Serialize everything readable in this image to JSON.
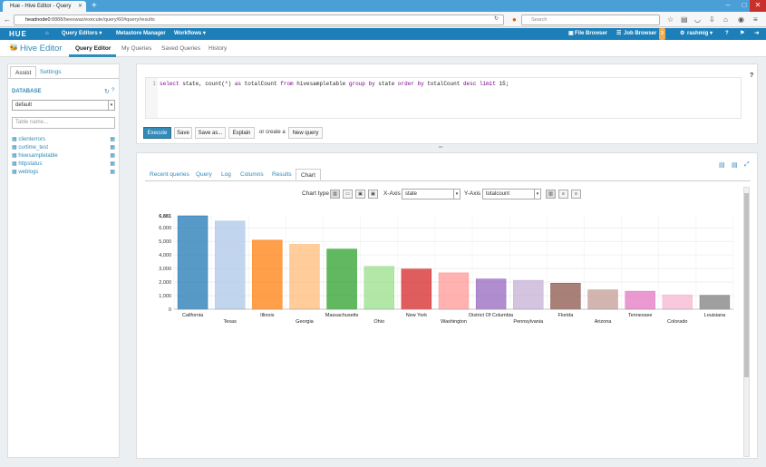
{
  "browser": {
    "tab_title": "Hue - Hive Editor - Query",
    "url_host": "headnode0",
    "url_rest": ":8888/beeswax/execute/query/60#query/results",
    "search_placeholder": "Search"
  },
  "hue_nav": {
    "logo": "HUE",
    "items": [
      "Query Editors ▾",
      "Metastore Manager",
      "Workflows ▾"
    ],
    "file_browser": "File Browser",
    "job_browser": "Job Browser",
    "job_badge": "3",
    "user": "rashmig ▾"
  },
  "subnav": {
    "title": "Hive Editor",
    "tabs": [
      "Query Editor",
      "My Queries",
      "Saved Queries",
      "History"
    ]
  },
  "assist": {
    "tabs": [
      "Assist",
      "Settings"
    ],
    "database_label": "DATABASE",
    "database_value": "default",
    "table_placeholder": "Table name...",
    "tables": [
      "clienterrors",
      "curtime_test",
      "hivesampletable",
      "httpstatus",
      "weblogs"
    ]
  },
  "editor": {
    "line_number": "1",
    "code_parts": [
      {
        "t": "select",
        "k": true
      },
      {
        "t": " state, count(*) ",
        "k": false
      },
      {
        "t": "as",
        "k": true
      },
      {
        "t": " totalCount ",
        "k": false
      },
      {
        "t": "from",
        "k": true
      },
      {
        "t": " hivesampletable ",
        "k": false
      },
      {
        "t": "group by",
        "k": true
      },
      {
        "t": " state ",
        "k": false
      },
      {
        "t": "order by",
        "k": true
      },
      {
        "t": " totalCount ",
        "k": false
      },
      {
        "t": "desc",
        "k": true
      },
      {
        "t": " ",
        "k": false
      },
      {
        "t": "limit",
        "k": true
      },
      {
        "t": " 15;",
        "k": false
      }
    ],
    "buttons": {
      "execute": "Execute",
      "save": "Save",
      "save_as": "Save as...",
      "explain": "Explain",
      "or_create": "or create a",
      "new_query": "New query"
    }
  },
  "results": {
    "tabs": [
      "Recent queries",
      "Query",
      "Log",
      "Columns",
      "Results",
      "Chart"
    ],
    "chart_type_label": "Chart type",
    "x_axis_label": "X-Axis",
    "x_axis_value": "state",
    "y_axis_label": "Y-Axis",
    "y_axis_value": "totalcount"
  },
  "chart_data": {
    "type": "bar",
    "categories": [
      "California",
      "Texas",
      "Illinois",
      "Georgia",
      "Massachusetts",
      "Ohio",
      "New York",
      "Washington",
      "District Of Columbia",
      "Pennsylvania",
      "Florida",
      "Arizona",
      "Tennessee",
      "Colorado",
      "Louisiana"
    ],
    "values": [
      6881,
      6500,
      5090,
      4780,
      4430,
      3160,
      2960,
      2680,
      2230,
      2130,
      1920,
      1430,
      1330,
      1060,
      1030
    ],
    "colors": [
      "#1f77b4",
      "#aec7e8",
      "#ff7f0e",
      "#ffbb78",
      "#2ca02c",
      "#98df8a",
      "#d62728",
      "#ff9896",
      "#9467bd",
      "#c5b0d5",
      "#8c564b",
      "#c49c94",
      "#e377c2",
      "#f7b6d2",
      "#7f7f7f"
    ],
    "y_ticks": [
      0,
      1000,
      2000,
      3000,
      4000,
      5000,
      6000
    ],
    "y_tick_labels": [
      "0",
      "1,000",
      "2,000",
      "3,000",
      "4,000",
      "5,000",
      "6,000"
    ],
    "y_max_label": "6,881",
    "ylim": [
      0,
      6881
    ],
    "grid": true
  }
}
